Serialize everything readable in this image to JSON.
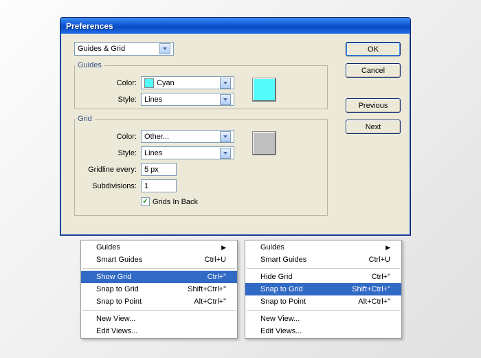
{
  "dialog": {
    "title": "Preferences",
    "category": "Guides & Grid",
    "guides": {
      "legend": "Guides",
      "color_label": "Color:",
      "color_value": "Cyan",
      "color_hex": "#54fcfb",
      "style_label": "Style:",
      "style_value": "Lines",
      "swatch_hex": "#54fcfb"
    },
    "grid": {
      "legend": "Grid",
      "color_label": "Color:",
      "color_value": "Other...",
      "style_label": "Style:",
      "style_value": "Lines",
      "gridline_label": "Gridline every:",
      "gridline_value": "5 px",
      "subdiv_label": "Subdivisions:",
      "subdiv_value": "1",
      "checkbox_label": "Grids In Back",
      "swatch_hex": "#bfbfbf"
    },
    "buttons": {
      "ok": "OK",
      "cancel": "Cancel",
      "previous": "Previous",
      "next": "Next"
    }
  },
  "menus": {
    "left": [
      {
        "type": "item",
        "label": "Guides",
        "sub": true
      },
      {
        "type": "item",
        "label": "Smart Guides",
        "accel": "Ctrl+U"
      },
      {
        "type": "sep"
      },
      {
        "type": "item",
        "label": "Show Grid",
        "accel": "Ctrl+\"",
        "selected": true
      },
      {
        "type": "item",
        "label": "Snap to Grid",
        "accel": "Shift+Ctrl+\""
      },
      {
        "type": "item",
        "label": "Snap to Point",
        "accel": "Alt+Ctrl+\""
      },
      {
        "type": "sep"
      },
      {
        "type": "item",
        "label": "New View..."
      },
      {
        "type": "item",
        "label": "Edit Views..."
      }
    ],
    "right": [
      {
        "type": "item",
        "label": "Guides",
        "sub": true
      },
      {
        "type": "item",
        "label": "Smart Guides",
        "accel": "Ctrl+U"
      },
      {
        "type": "sep"
      },
      {
        "type": "item",
        "label": "Hide Grid",
        "accel": "Ctrl+\""
      },
      {
        "type": "item",
        "label": "Snap to Grid",
        "accel": "Shift+Ctrl+\"",
        "selected": true
      },
      {
        "type": "item",
        "label": "Snap to Point",
        "accel": "Alt+Ctrl+\""
      },
      {
        "type": "sep"
      },
      {
        "type": "item",
        "label": "New View..."
      },
      {
        "type": "item",
        "label": "Edit Views..."
      }
    ]
  }
}
